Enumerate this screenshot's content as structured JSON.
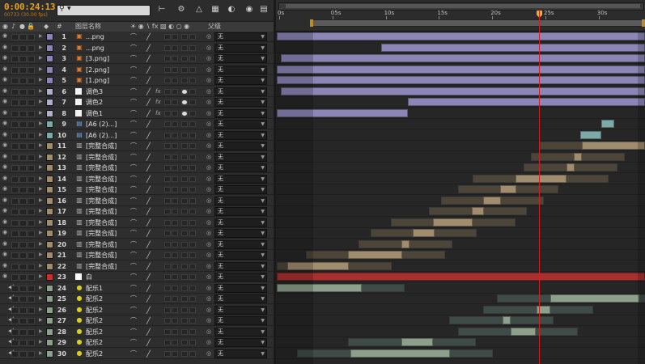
{
  "header": {
    "timecode": "0:00:24:13",
    "frames": "00733 (30.00 fps)",
    "search_placeholder": "",
    "col_hash": "#",
    "col_name": "图层名称",
    "col_parent": "父级"
  },
  "ruler": {
    "ticks": [
      "0s",
      "05s",
      "10s",
      "15s",
      "20s",
      "25s",
      "30s"
    ],
    "current_time_seconds": 24.4
  },
  "colors": {
    "purple": "#8b86b5",
    "purple_lane": "#4a4760",
    "tan": "#a08c6e",
    "tan_lane": "#4d4538",
    "gray": "#9aa0a0",
    "gray_lane": "#4a4e4e",
    "teal": "#7ea9a6",
    "red": "#aa3030",
    "green": "#8ca08c",
    "green_lane": "#3f4b47",
    "cti": "#d02020",
    "timecode": "#e8a020"
  },
  "layers": [
    {
      "num": "1",
      "name": "...png",
      "type": "png",
      "label": "#8b86b5",
      "parent": "无",
      "bar_start": 0,
      "bar_end": 35,
      "color": "purple"
    },
    {
      "num": "2",
      "name": "...png",
      "type": "png",
      "label": "#8b86b5",
      "parent": "无",
      "bar_start": 9.8,
      "bar_end": 35,
      "color": "purple"
    },
    {
      "num": "3",
      "name": "[3.png]",
      "type": "png",
      "label": "#8b86b5",
      "parent": "无",
      "bar_start": 0.4,
      "bar_end": 35,
      "color": "purple"
    },
    {
      "num": "4",
      "name": "[2.png]",
      "type": "png",
      "label": "#8b86b5",
      "parent": "无",
      "bar_start": 0,
      "bar_end": 35,
      "color": "purple"
    },
    {
      "num": "5",
      "name": "[1.png]",
      "type": "png",
      "label": "#8b86b5",
      "parent": "无",
      "bar_start": 0,
      "bar_end": 35,
      "color": "purple"
    },
    {
      "num": "6",
      "name": "调色3",
      "type": "solid",
      "label": "#b0b0c8",
      "parent": "无",
      "bar_start": 0.4,
      "bar_end": 35,
      "color": "purple",
      "fx": true
    },
    {
      "num": "7",
      "name": "调色2",
      "type": "solid",
      "label": "#b0b0c8",
      "parent": "无",
      "bar_start": 12.3,
      "bar_end": 35,
      "color": "purple",
      "fx": true
    },
    {
      "num": "8",
      "name": "调色1",
      "type": "solid",
      "label": "#b0b0c8",
      "parent": "无",
      "bar_start": 0,
      "bar_end": 12.3,
      "color": "purple",
      "fx": true
    },
    {
      "num": "9",
      "name": "[A6 (2)...]",
      "type": "footage",
      "label": "#7ea9a6",
      "parent": "无",
      "bar_start": 30.5,
      "bar_end": 31.7,
      "color": "teal"
    },
    {
      "num": "10",
      "name": "[A6 (2)...]",
      "type": "footage",
      "label": "#7ea9a6",
      "parent": "无",
      "bar_start": 28.5,
      "bar_end": 30.5,
      "color": "teal"
    },
    {
      "num": "11",
      "name": "[完整合成]",
      "type": "comp",
      "label": "#a08c6e",
      "parent": "无",
      "bar_start": 28.7,
      "bar_end": 35,
      "color": "tan"
    },
    {
      "num": "12",
      "name": "[完整合成]",
      "type": "comp",
      "label": "#a08c6e",
      "parent": "无",
      "bar_start": 27.9,
      "bar_end": 28.7,
      "color": "tan"
    },
    {
      "num": "13",
      "name": "[完整合成]",
      "type": "comp",
      "label": "#a08c6e",
      "parent": "无",
      "bar_start": 27.2,
      "bar_end": 28.0,
      "color": "tan"
    },
    {
      "num": "14",
      "name": "[完整合成]",
      "type": "comp",
      "label": "#a08c6e",
      "parent": "无",
      "bar_start": 22.4,
      "bar_end": 27.2,
      "color": "tan"
    },
    {
      "num": "15",
      "name": "[完整合成]",
      "type": "comp",
      "label": "#a08c6e",
      "parent": "无",
      "bar_start": 21.0,
      "bar_end": 22.5,
      "color": "tan"
    },
    {
      "num": "16",
      "name": "[完整合成]",
      "type": "comp",
      "label": "#a08c6e",
      "parent": "无",
      "bar_start": 19.4,
      "bar_end": 21.1,
      "color": "tan"
    },
    {
      "num": "17",
      "name": "[完整合成]",
      "type": "comp",
      "label": "#a08c6e",
      "parent": "无",
      "bar_start": 18.3,
      "bar_end": 19.5,
      "color": "tan"
    },
    {
      "num": "18",
      "name": "[完整合成]",
      "type": "comp",
      "label": "#a08c6e",
      "parent": "无",
      "bar_start": 14.7,
      "bar_end": 18.4,
      "color": "tan"
    },
    {
      "num": "19",
      "name": "[完整合成]",
      "type": "comp",
      "label": "#a08c6e",
      "parent": "无",
      "bar_start": 12.8,
      "bar_end": 14.8,
      "color": "tan"
    },
    {
      "num": "20",
      "name": "[完整合成]",
      "type": "comp",
      "label": "#a08c6e",
      "parent": "无",
      "bar_start": 11.7,
      "bar_end": 12.5,
      "color": "tan"
    },
    {
      "num": "21",
      "name": "[完整合成]",
      "type": "comp",
      "label": "#a08c6e",
      "parent": "无",
      "bar_start": 6.7,
      "bar_end": 11.8,
      "color": "tan"
    },
    {
      "num": "22",
      "name": "[完整合成]",
      "type": "comp",
      "label": "#a08c6e",
      "parent": "无",
      "bar_start": 1.0,
      "bar_end": 6.8,
      "color": "tan"
    },
    {
      "num": "23",
      "name": "白",
      "type": "solid",
      "label": "#c83030",
      "parent": "无",
      "bar_start": 0,
      "bar_end": 35,
      "color": "red"
    },
    {
      "num": "24",
      "name": "配乐1",
      "type": "audio",
      "label": "#8ca08c",
      "parent": "无",
      "bar_start": 0,
      "bar_end": 8.0,
      "color": "green"
    },
    {
      "num": "25",
      "name": "配乐2",
      "type": "audio",
      "label": "#8ca08c",
      "parent": "无",
      "bar_start": 25.7,
      "bar_end": 34.1,
      "color": "green"
    },
    {
      "num": "26",
      "name": "配乐2",
      "type": "audio",
      "label": "#8ca08c",
      "parent": "无",
      "bar_start": 24.4,
      "bar_end": 25.7,
      "color": "green"
    },
    {
      "num": "27",
      "name": "配乐2",
      "type": "audio",
      "label": "#8ca08c",
      "parent": "无",
      "bar_start": 21.2,
      "bar_end": 22.0,
      "color": "green"
    },
    {
      "num": "28",
      "name": "配乐2",
      "type": "audio",
      "label": "#8ca08c",
      "parent": "无",
      "bar_start": 22.0,
      "bar_end": 24.3,
      "color": "green"
    },
    {
      "num": "29",
      "name": "配乐2",
      "type": "audio",
      "label": "#8ca08c",
      "parent": "无",
      "bar_start": 11.7,
      "bar_end": 14.7,
      "color": "green"
    },
    {
      "num": "30",
      "name": "配乐2",
      "type": "audio",
      "label": "#8ca08c",
      "parent": "无",
      "bar_start": 6.9,
      "bar_end": 16.3,
      "color": "green"
    }
  ]
}
